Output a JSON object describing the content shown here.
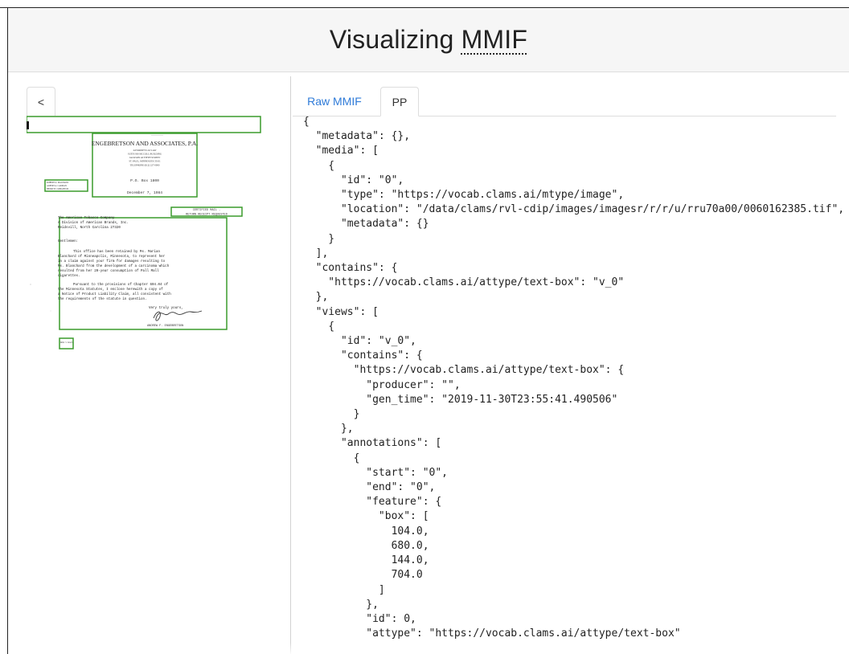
{
  "header": {
    "title_prefix": "Visualizing ",
    "title_abbr": "MMIF"
  },
  "nav": {
    "back_label": "<"
  },
  "tabs": [
    {
      "label": "Raw MMIF",
      "active": false
    },
    {
      "label": "PP",
      "active": true
    }
  ],
  "document": {
    "firm_name": "ENGEBRETSON AND ASSOCIATES, P.A.",
    "firm_lines": [
      "ATTORNEYS AT LAW",
      "SUITE 930 MCCOLL BUILDING",
      "JACKSON AT FIFTH STREET",
      "ST. PAUL, MINNESOTA 55101",
      "TELEPHONE (612) 227-0000"
    ],
    "po_box": "P.O. Box 1800",
    "date": "December 7, 1984",
    "certified": "CERTIFIED MAIL -",
    "return_receipt": "RETURN RECEIPT REQUESTED",
    "left_block": [
      "ROBERT A. MAGNANO",
      "ALBERT A. CARMAN",
      "HENRY B. CREIGHTON"
    ],
    "addressee": [
      "The American Tobacco Company",
      "A Division of American Brands, Inc.",
      "Reidsvill, North Carolina 27320"
    ],
    "salutation": "Gentlemen:",
    "para1": [
      "This office has been retained by Ms. Marian",
      "Blanchard of Minneapolis, Minnesota, to represent her",
      "in a claim against your firm for damages resulting to",
      "Ms. Blanchard from the development of a carcinoma which",
      "resulted from her 20-year consumption of Pall Mall",
      "cigarettes."
    ],
    "para2": [
      "Pursuant to the provisions of Chapter 604.04 of",
      "the Minnesota Statutes, I enclose herewith a copy of",
      "a Notice of Product Liability Claim, all consistent with",
      "the requirements of the statute in question."
    ],
    "closing": "Very truly yours,",
    "signer": "ANDREW F. ENGEBRETSON",
    "enclosure": "AFE:l Encl."
  },
  "colors": {
    "box_stroke": "#3a9b2c",
    "tab_link": "#2f7bd8"
  },
  "mmif_json_lines": [
    "{",
    "  \"metadata\": {},",
    "  \"media\": [",
    "    {",
    "      \"id\": \"0\",",
    "      \"type\": \"https://vocab.clams.ai/mtype/image\",",
    "      \"location\": \"/data/clams/rvl-cdip/images/imagesr/r/r/u/rru70a00/0060162385.tif\",",
    "      \"metadata\": {}",
    "    }",
    "  ],",
    "  \"contains\": {",
    "    \"https://vocab.clams.ai/attype/text-box\": \"v_0\"",
    "  },",
    "  \"views\": [",
    "    {",
    "      \"id\": \"v_0\",",
    "      \"contains\": {",
    "        \"https://vocab.clams.ai/attype/text-box\": {",
    "          \"producer\": \"\",",
    "          \"gen_time\": \"2019-11-30T23:55:41.490506\"",
    "        }",
    "      },",
    "      \"annotations\": [",
    "        {",
    "          \"start\": \"0\",",
    "          \"end\": \"0\",",
    "          \"feature\": {",
    "            \"box\": [",
    "              104.0,",
    "              680.0,",
    "              144.0,",
    "              704.0",
    "            ]",
    "          },",
    "          \"id\": 0,",
    "          \"attype\": \"https://vocab.clams.ai/attype/text-box\""
  ]
}
